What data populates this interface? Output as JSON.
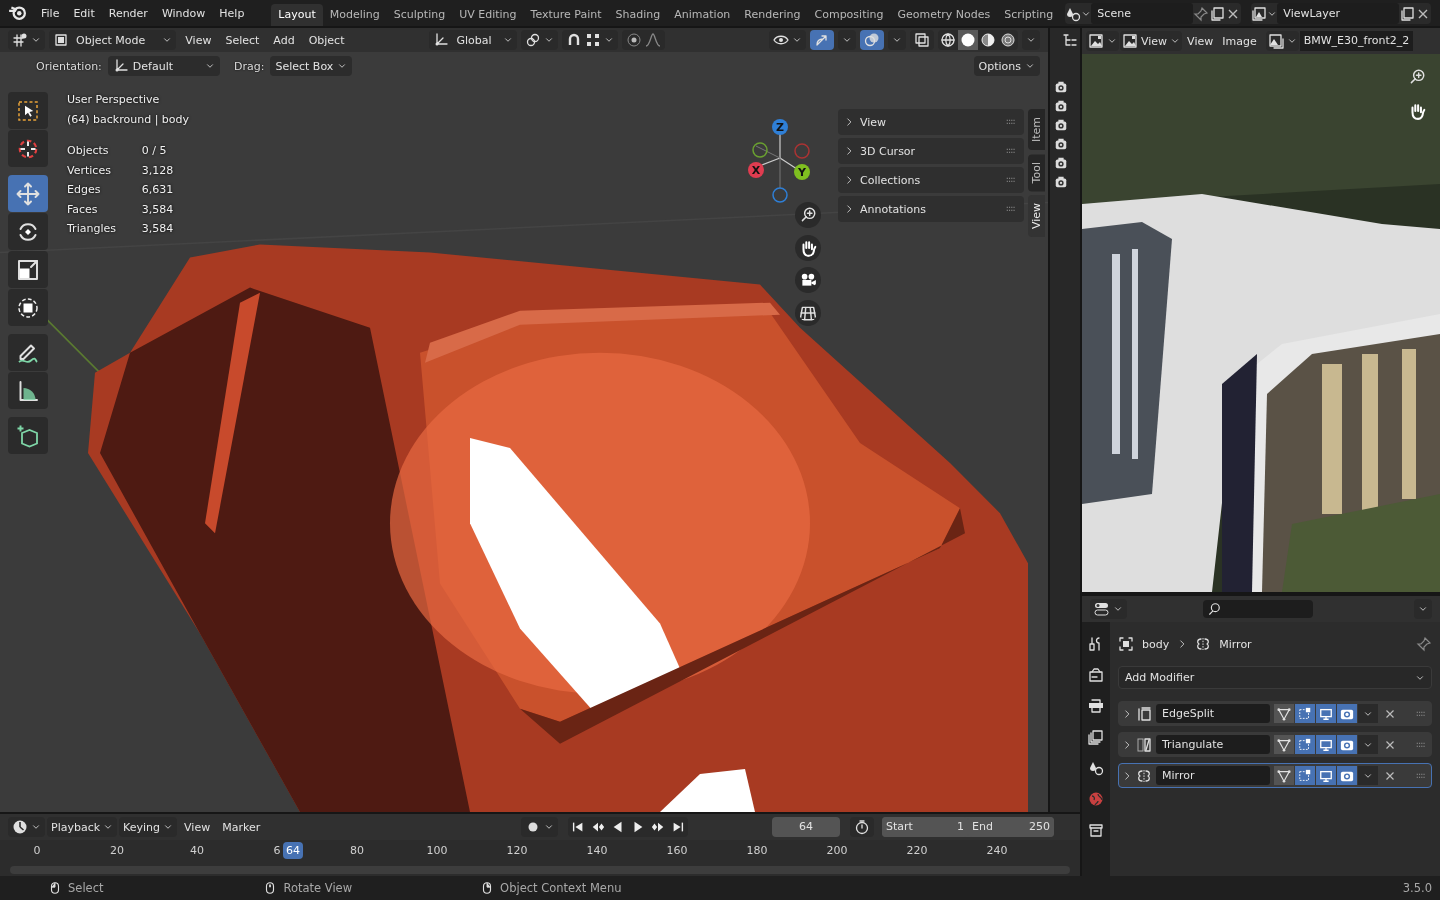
{
  "topbar": {
    "menus": [
      "File",
      "Edit",
      "Render",
      "Window",
      "Help"
    ],
    "workspaces": [
      {
        "label": "Layout",
        "selected": true
      },
      {
        "label": "Modeling",
        "selected": false
      },
      {
        "label": "Sculpting",
        "selected": false
      },
      {
        "label": "UV Editing",
        "selected": false
      },
      {
        "label": "Texture Paint",
        "selected": false
      },
      {
        "label": "Shading",
        "selected": false
      },
      {
        "label": "Animation",
        "selected": false
      },
      {
        "label": "Rendering",
        "selected": false
      },
      {
        "label": "Compositing",
        "selected": false
      },
      {
        "label": "Geometry Nodes",
        "selected": false
      },
      {
        "label": "Scripting",
        "selected": false
      }
    ],
    "scene": "Scene",
    "view_layer": "ViewLayer"
  },
  "viewport": {
    "header": {
      "mode": "Object Mode",
      "menus": [
        "View",
        "Select",
        "Add",
        "Object"
      ],
      "orientation": "Global",
      "toggles": [
        {
          "kind": "gizmo",
          "on": true
        },
        {
          "kind": "overlays",
          "on": true
        },
        {
          "kind": "xray",
          "on": false
        }
      ],
      "shading": [
        {
          "kind": "wireframe",
          "selected": false
        },
        {
          "kind": "solid",
          "selected": true
        },
        {
          "kind": "material",
          "selected": false
        },
        {
          "kind": "rendered",
          "selected": false
        }
      ]
    },
    "tool_settings": {
      "orientation_label": "Orientation:",
      "orientation": "Default",
      "drag_label": "Drag:",
      "drag": "Select Box",
      "options": "Options"
    },
    "tools": [
      {
        "kind": "select",
        "selected": false
      },
      {
        "kind": "cursor",
        "selected": false
      },
      {
        "kind": "move",
        "selected": true
      },
      {
        "kind": "rotate",
        "selected": false
      },
      {
        "kind": "scale",
        "selected": false
      },
      {
        "kind": "transform",
        "selected": false
      },
      {
        "kind": "annotate",
        "selected": false
      },
      {
        "kind": "measure",
        "selected": false
      },
      {
        "kind": "add_cube",
        "selected": false
      }
    ],
    "info": {
      "perspective": "User Perspective",
      "object": "(64) backround | body",
      "stats": [
        {
          "label": "Objects",
          "value": "0 / 5"
        },
        {
          "label": "Vertices",
          "value": "3,128"
        },
        {
          "label": "Edges",
          "value": "6,631"
        },
        {
          "label": "Faces",
          "value": "3,584"
        },
        {
          "label": "Triangles",
          "value": "3,584"
        }
      ]
    },
    "gizmo": {
      "x": "X",
      "y": "Y",
      "z": "Z"
    },
    "sidebar": {
      "panels": [
        "View",
        "3D Cursor",
        "Collections",
        "Annotations"
      ],
      "tabs": [
        {
          "label": "Item",
          "selected": false
        },
        {
          "label": "Tool",
          "selected": false
        },
        {
          "label": "View",
          "selected": true
        }
      ]
    }
  },
  "image_editor": {
    "menus": [
      "View",
      "View",
      "Image"
    ],
    "image": "BMW_E30_front2_2"
  },
  "properties": {
    "breadcrumb": [
      "body",
      "Mirror"
    ],
    "add_modifier": "Add Modifier",
    "modifiers": [
      {
        "kind": "edge_split",
        "name": "EdgeSplit",
        "active": false,
        "on_cage": false,
        "edit_mode": true,
        "viewport": true,
        "render": true
      },
      {
        "kind": "triangulate",
        "name": "Triangulate",
        "active": false,
        "on_cage": false,
        "edit_mode": true,
        "viewport": true,
        "render": true
      },
      {
        "kind": "mirror",
        "name": "Mirror",
        "active": true,
        "on_cage": false,
        "edit_mode": true,
        "viewport": true,
        "render": true
      }
    ]
  },
  "timeline": {
    "menus": [
      "Playback",
      "Keying",
      "View",
      "Marker"
    ],
    "current_frame": "64",
    "start_label": "Start",
    "start": "1",
    "end_label": "End",
    "end": "250",
    "ticks": [
      "0",
      "20",
      "40",
      "6",
      "80",
      "100",
      "120",
      "140",
      "160",
      "180",
      "200",
      "220",
      "240"
    ],
    "playhead": {
      "label": "64",
      "level": 0.279
    }
  },
  "status_bar": {
    "hints": [
      "Select",
      "Rotate View",
      "Object Context Menu"
    ],
    "version": "3.5.0"
  }
}
